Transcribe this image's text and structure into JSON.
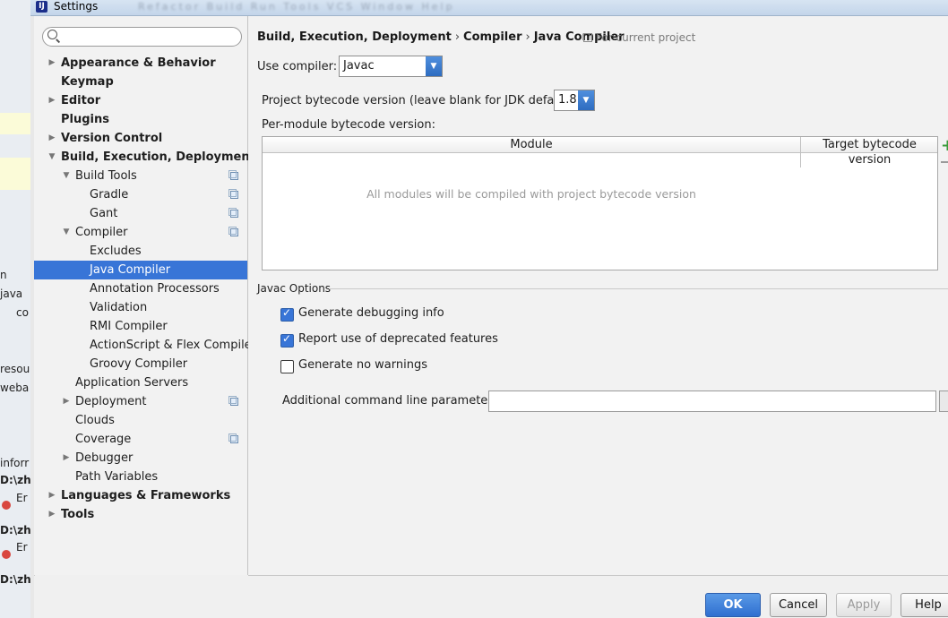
{
  "window": {
    "title": "Settings",
    "app_icon": "ij-logo-icon"
  },
  "background_ide": {
    "texts": [
      "n",
      "java",
      "co",
      "resou",
      "weba",
      "inforr",
      "D:\\zh",
      "Er",
      "D:\\zh",
      "Er",
      "D:\\zh"
    ]
  },
  "search": {
    "placeholder": "",
    "value": ""
  },
  "tree": [
    {
      "label": "Appearance & Behavior",
      "level": 0,
      "bold": true,
      "arrow": "right",
      "copy": false,
      "selected": false
    },
    {
      "label": "Keymap",
      "level": 0,
      "bold": true,
      "arrow": "",
      "copy": false,
      "selected": false
    },
    {
      "label": "Editor",
      "level": 0,
      "bold": true,
      "arrow": "right",
      "copy": false,
      "selected": false
    },
    {
      "label": "Plugins",
      "level": 0,
      "bold": true,
      "arrow": "",
      "copy": false,
      "selected": false
    },
    {
      "label": "Version Control",
      "level": 0,
      "bold": true,
      "arrow": "right",
      "copy": false,
      "selected": false
    },
    {
      "label": "Build, Execution, Deployment",
      "level": 0,
      "bold": true,
      "arrow": "down",
      "copy": false,
      "selected": false
    },
    {
      "label": "Build Tools",
      "level": 1,
      "bold": false,
      "arrow": "down",
      "copy": true,
      "selected": false
    },
    {
      "label": "Gradle",
      "level": 2,
      "bold": false,
      "arrow": "",
      "copy": true,
      "selected": false
    },
    {
      "label": "Gant",
      "level": 2,
      "bold": false,
      "arrow": "",
      "copy": true,
      "selected": false
    },
    {
      "label": "Compiler",
      "level": 1,
      "bold": false,
      "arrow": "down",
      "copy": true,
      "selected": false
    },
    {
      "label": "Excludes",
      "level": 2,
      "bold": false,
      "arrow": "",
      "copy": false,
      "selected": false
    },
    {
      "label": "Java Compiler",
      "level": 2,
      "bold": false,
      "arrow": "",
      "copy": false,
      "selected": true
    },
    {
      "label": "Annotation Processors",
      "level": 2,
      "bold": false,
      "arrow": "",
      "copy": false,
      "selected": false
    },
    {
      "label": "Validation",
      "level": 2,
      "bold": false,
      "arrow": "",
      "copy": false,
      "selected": false
    },
    {
      "label": "RMI Compiler",
      "level": 2,
      "bold": false,
      "arrow": "",
      "copy": false,
      "selected": false
    },
    {
      "label": "ActionScript & Flex Compiler",
      "level": 2,
      "bold": false,
      "arrow": "",
      "copy": false,
      "selected": false
    },
    {
      "label": "Groovy Compiler",
      "level": 2,
      "bold": false,
      "arrow": "",
      "copy": false,
      "selected": false
    },
    {
      "label": "Application Servers",
      "level": 1,
      "bold": false,
      "arrow": "",
      "copy": false,
      "selected": false
    },
    {
      "label": "Deployment",
      "level": 1,
      "bold": false,
      "arrow": "right",
      "copy": true,
      "selected": false
    },
    {
      "label": "Clouds",
      "level": 1,
      "bold": false,
      "arrow": "",
      "copy": false,
      "selected": false
    },
    {
      "label": "Coverage",
      "level": 1,
      "bold": false,
      "arrow": "",
      "copy": true,
      "selected": false
    },
    {
      "label": "Debugger",
      "level": 1,
      "bold": false,
      "arrow": "right",
      "copy": false,
      "selected": false
    },
    {
      "label": "Path Variables",
      "level": 1,
      "bold": false,
      "arrow": "",
      "copy": false,
      "selected": false
    },
    {
      "label": "Languages & Frameworks",
      "level": 0,
      "bold": true,
      "arrow": "right",
      "copy": false,
      "selected": false
    },
    {
      "label": "Tools",
      "level": 0,
      "bold": true,
      "arrow": "right",
      "copy": false,
      "selected": false
    }
  ],
  "breadcrumb": {
    "items": [
      "Build, Execution, Deployment",
      "Compiler",
      "Java Compiler"
    ],
    "separator": "›",
    "scope": "For current project"
  },
  "compiler": {
    "use_label": "Use compiler:",
    "use_value": "Javac",
    "bytecode_label": "Project bytecode version (leave blank for JDK default):",
    "bytecode_value": "1.8",
    "per_module_label": "Per-module bytecode version:"
  },
  "module_table": {
    "columns": [
      "Module",
      "Target bytecode version"
    ],
    "empty_text": "All modules will be compiled with project bytecode version",
    "add": "+"
  },
  "javac": {
    "group_label": "Javac Options",
    "options": [
      {
        "label": "Generate debugging info",
        "checked": true
      },
      {
        "label": "Report use of deprecated features",
        "checked": true
      },
      {
        "label": "Generate no warnings",
        "checked": false
      }
    ],
    "params_label": "Additional command line parameters:",
    "params_value": ""
  },
  "buttons": {
    "ok": "OK",
    "cancel": "Cancel",
    "apply": "Apply",
    "help": "Help"
  },
  "colors": {
    "selection": "#3875d7",
    "primary_button": "#2f6fd0",
    "add_green": "#3a9b3a"
  }
}
